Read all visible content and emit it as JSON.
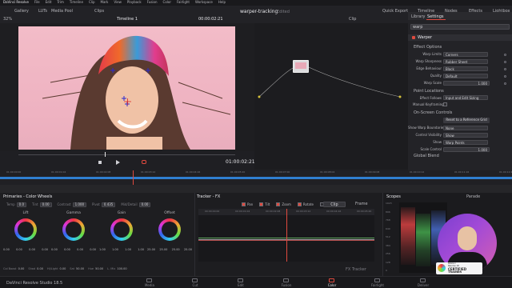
{
  "menu": {
    "items": [
      "DaVinci Resolve",
      "File",
      "Edit",
      "Trim",
      "Timeline",
      "Clip",
      "Mark",
      "View",
      "Playback",
      "Fusion",
      "Color",
      "Fairlight",
      "Workspace",
      "Help"
    ],
    "project_title": "warper-tracking",
    "project_status": "Edited",
    "right": [
      "Quick Export",
      "Timeline",
      "Nodes",
      "Effects",
      "Lightbox"
    ]
  },
  "toolbar": {
    "zoom": "32%",
    "gallery": "Gallery",
    "luts": "LUTs",
    "media_pool": "Media Pool",
    "clips": "Clips",
    "timeline_name": "Timeline 1",
    "timecode": "00:00:02:21",
    "clip_menu": "Clip"
  },
  "viewer": {
    "timecode": "01:00:02:21",
    "scrub_timecode": "00:00:02:21"
  },
  "inspector": {
    "tabs": [
      "Library",
      "Settings"
    ],
    "search_placeholder": "warp",
    "effect_title": "Warper",
    "section_effect_options": "Effect Options",
    "section_point_locations": "Point Locations",
    "section_onscreen": "On-Screen Controls",
    "section_global_blend": "Global Blend",
    "params": [
      {
        "label": "Warp Limits",
        "value": "Corners"
      },
      {
        "label": "Warp Sharpness",
        "value": "Rubber Sheet"
      },
      {
        "label": "Edge Behaviour",
        "value": "Black"
      },
      {
        "label": "Quality",
        "value": "Default"
      },
      {
        "label": "Warp Scale",
        "value": "1.000"
      }
    ],
    "effect_follows_label": "Effect Follows",
    "effect_follows_value": "Input and Edit Sizing",
    "manual_keyframing": "Manual Keyframing",
    "reset_grid": "Reset to a Reference Grid",
    "onscreen_params": [
      {
        "label": "Show Warp Boundaries",
        "value": "None"
      },
      {
        "label": "Control Visibility",
        "value": "Show"
      },
      {
        "label": "Show",
        "value": "Warp Points"
      },
      {
        "label": "Scale Control",
        "value": "1.000"
      }
    ]
  },
  "timeline_ruler": [
    "01:00:00:00",
    "01:00:01:04",
    "01:00:02:08",
    "01:00:03:12",
    "01:00:04:16",
    "01:00:05:20",
    "01:00:07:00",
    "01:00:08:04",
    "01:00:09:08",
    "01:00:10:12",
    "01:00:11:16",
    "01:00:12:20"
  ],
  "primaries": {
    "title": "Primaries - Color Wheels",
    "params": [
      {
        "label": "Temp",
        "value": "0.0"
      },
      {
        "label": "Tint",
        "value": "0.00"
      },
      {
        "label": "Contrast",
        "value": "1.000"
      },
      {
        "label": "Pivot",
        "value": "0.435"
      },
      {
        "label": "Mid/Detail",
        "value": "0.00"
      }
    ],
    "wheels": [
      {
        "name": "Lift",
        "values": [
          "0.00",
          "0.00",
          "0.00",
          "0.00"
        ]
      },
      {
        "name": "Gamma",
        "values": [
          "0.00",
          "0.00",
          "0.00",
          "0.00"
        ]
      },
      {
        "name": "Gain",
        "values": [
          "1.00",
          "1.00",
          "1.00",
          "1.00"
        ]
      },
      {
        "name": "Offset",
        "values": [
          "25.00",
          "25.00",
          "25.00",
          "25.00"
        ]
      }
    ],
    "bottom": [
      {
        "label": "Col Boost",
        "value": "0.00"
      },
      {
        "label": "Shad",
        "value": "0.00"
      },
      {
        "label": "Hi/Light",
        "value": "0.00"
      },
      {
        "label": "Sat",
        "value": "50.00"
      },
      {
        "label": "Hue",
        "value": "50.00"
      },
      {
        "label": "L. Mix",
        "value": "100.00"
      }
    ]
  },
  "tracker": {
    "title": "Tracker - FX",
    "options": [
      "Pan",
      "Tilt",
      "Zoom",
      "Rotate",
      "3D"
    ],
    "clip": "Clip",
    "frame": "Frame",
    "ruler": [
      "00:00:00:00",
      "00:00:01:04",
      "00:00:02:08",
      "00:00:03:12",
      "00:00:04:16",
      "00:00:05:20"
    ],
    "footer": "FX Tracker"
  },
  "scopes": {
    "title": "Scopes",
    "mode": "Parade",
    "scale": [
      "1023",
      "896",
      "768",
      "640",
      "512",
      "384",
      "256",
      "128",
      "0"
    ]
  },
  "badge": {
    "line1": "DaVinci",
    "line2": "Resolve 18",
    "line3": "CERTIFIED",
    "line4": "TRAINER"
  },
  "footer": {
    "app_name": "DaVinci Resolve Studio 18.5",
    "pages": [
      "Media",
      "Cut",
      "Edit",
      "Fusion",
      "Color",
      "Fairlight",
      "Deliver"
    ],
    "active_page": "Color"
  },
  "colors": {
    "accent": "#e04a3f",
    "panel": "#28282c",
    "background": "#1e1e21"
  }
}
